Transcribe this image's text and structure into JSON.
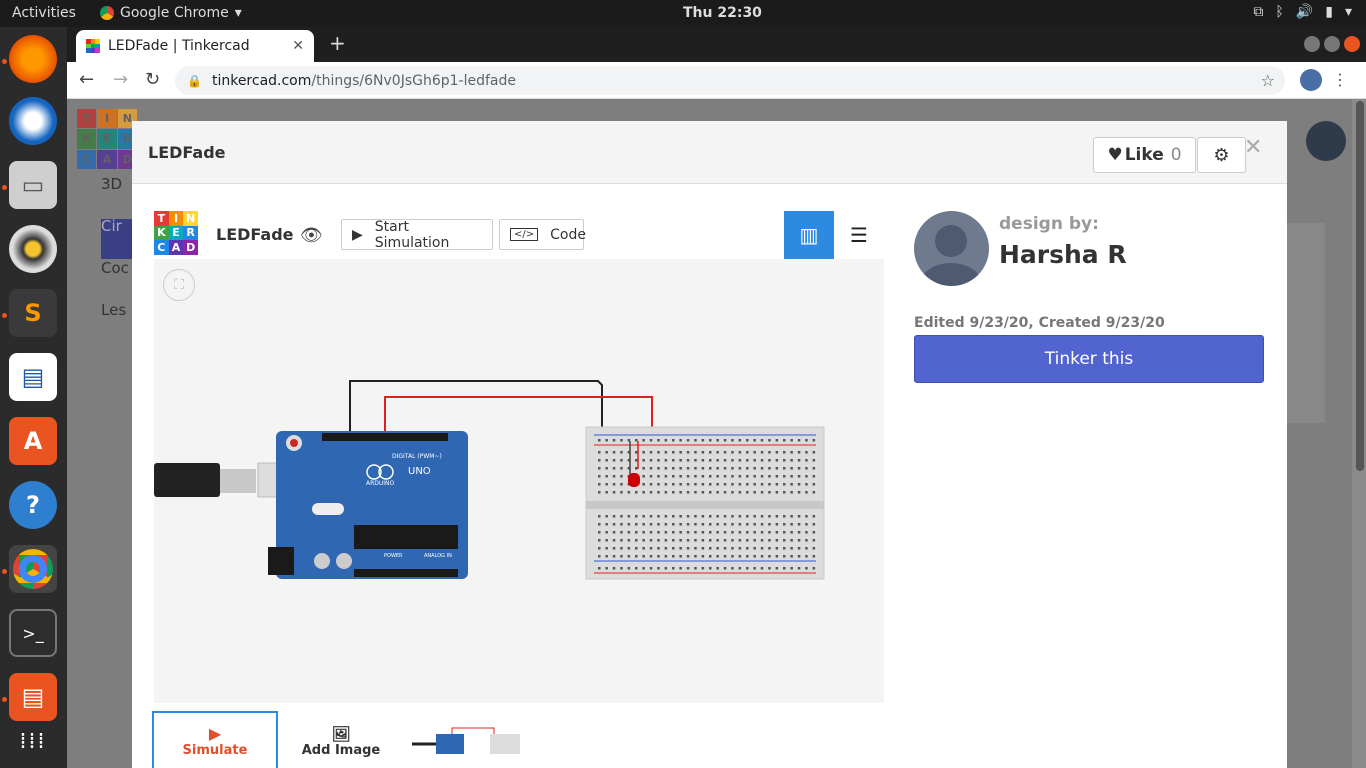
{
  "os": {
    "activities": "Activities",
    "app_name": "Google Chrome",
    "clock": "Thu 22:30",
    "dock_icons": [
      "firefox-icon",
      "thunderbird-icon",
      "files-icon",
      "rhythmbox-icon",
      "sublime-text-icon",
      "libreoffice-writer-icon",
      "software-center-icon",
      "help-icon",
      "chrome-icon",
      "terminal-icon",
      "impress-icon",
      "app-grid-icon"
    ]
  },
  "browser": {
    "tab_title": "LEDFade | Tinkercad",
    "url_host": "tinkercad.com",
    "url_path": "/things/6Nv0JsGh6p1-ledfade"
  },
  "background_page": {
    "side_items": [
      "3D",
      "Cir",
      "Coc",
      "Les"
    ],
    "tinkercad_logo": [
      "T",
      "I",
      "N",
      "K",
      "E",
      "R",
      "C",
      "A",
      "D"
    ]
  },
  "modal": {
    "title": "LEDFade",
    "like_label": "Like",
    "like_count": "0",
    "viewer": {
      "name": "LEDFade",
      "start_simulation": "Start Simulation",
      "code": "Code"
    },
    "thumbnails": {
      "simulate": "Simulate",
      "add_image": "Add Image"
    },
    "designer": {
      "design_by": "design by:",
      "name": "Harsha R",
      "dates": "Edited 9/23/20, Created 9/23/20",
      "tinker_button": "Tinker this"
    },
    "circuit": {
      "board": "Arduino UNO",
      "board_labels": [
        "DIGITAL (PWM~)",
        "UNO",
        "ARDUINO",
        "POWER",
        "ANALOG IN"
      ]
    }
  },
  "colors": {
    "accent_blue": "#2c8ae0",
    "tinker_button": "#5264d0",
    "arduino": "#2f67b3",
    "wire_red": "#e02020",
    "wire_black": "#222222"
  }
}
